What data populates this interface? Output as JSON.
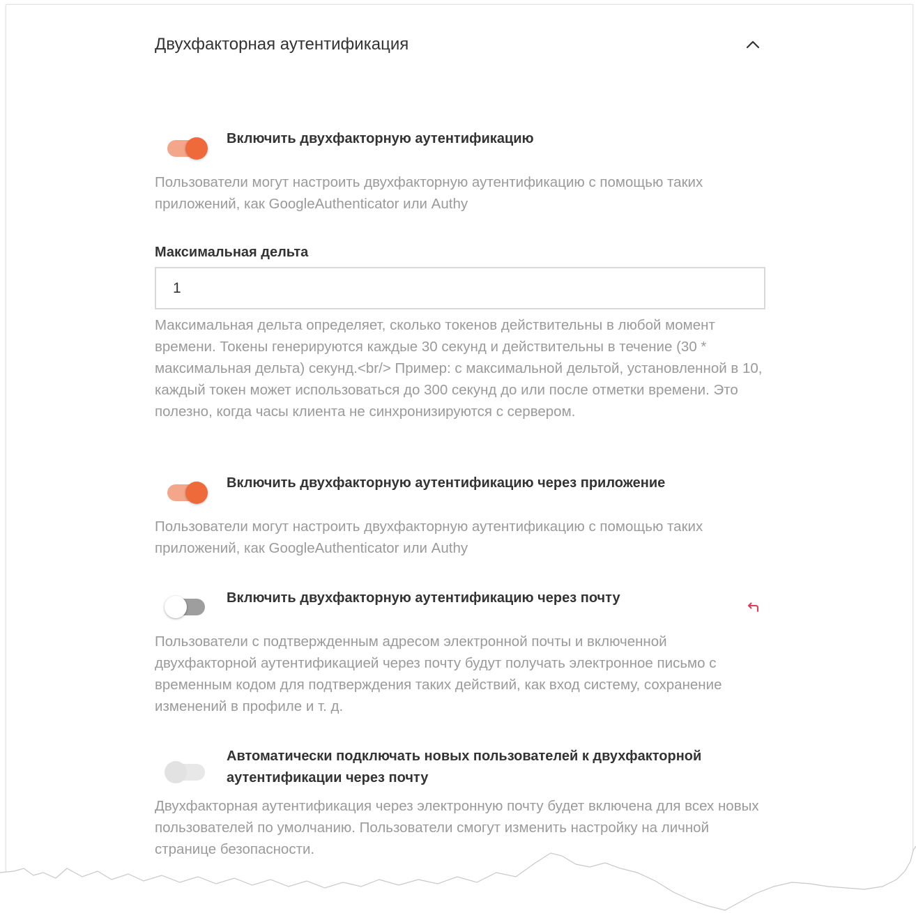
{
  "section": {
    "title": "Двухфакторная аутентификация",
    "expanded": true
  },
  "options": [
    {
      "label": "Включить двухфакторную аутентификацию",
      "state": "on",
      "description": "Пользователи могут настроить двухфакторную аутентификацию с помощью таких приложений, как GoogleAuthenticator или Authy"
    },
    {
      "label": "Включить двухфакторную аутентификацию через приложение",
      "state": "on",
      "description": "Пользователи могут настроить двухфакторную аутентификацию с помощью таких приложений, как GoogleAuthenticator или Authy"
    },
    {
      "label": "Включить двухфакторную аутентификацию через почту",
      "state": "off",
      "description": "Пользователи с подтвержденным адресом электронной почты и включенной двухфакторной аутентификацией через почту будут получать электронное письмо с временным кодом для подтверждения таких действий, как вход систему, сохранение изменений в профиле и т. д."
    },
    {
      "label": "Автоматически подключать новых пользователей к двухфакторной аутентификации через почту",
      "state": "disabled",
      "description": "Двухфакторная аутентификация через электронную почту будет включена для всех новых пользователей по умолчанию. Пользователи смогут изменить настройку на личной странице безопасности."
    }
  ],
  "max_delta": {
    "label": "Максимальная дельта",
    "value": "1",
    "description": "Максимальная дельта определяет, сколько токенов действительны в любой момент времени. Токены генерируются каждые 30 секунд и действительны в течение (30 * максимальная дельта) секунд.<br/> Пример: с максимальной дельтой, установленной в 10, каждый токен может использоваться до 300 секунд до или после отметки времени. Это полезно, когда часы клиента не синхронизируются с сервером."
  },
  "icons": {
    "collapse": "chevron-up-icon",
    "reset": "undo-arrow-icon"
  },
  "colors": {
    "accent": "#ee6a3b",
    "accent_track": "#f4a68b",
    "reset": "#e53957",
    "text": "#333333",
    "muted": "#9a9a9a"
  }
}
